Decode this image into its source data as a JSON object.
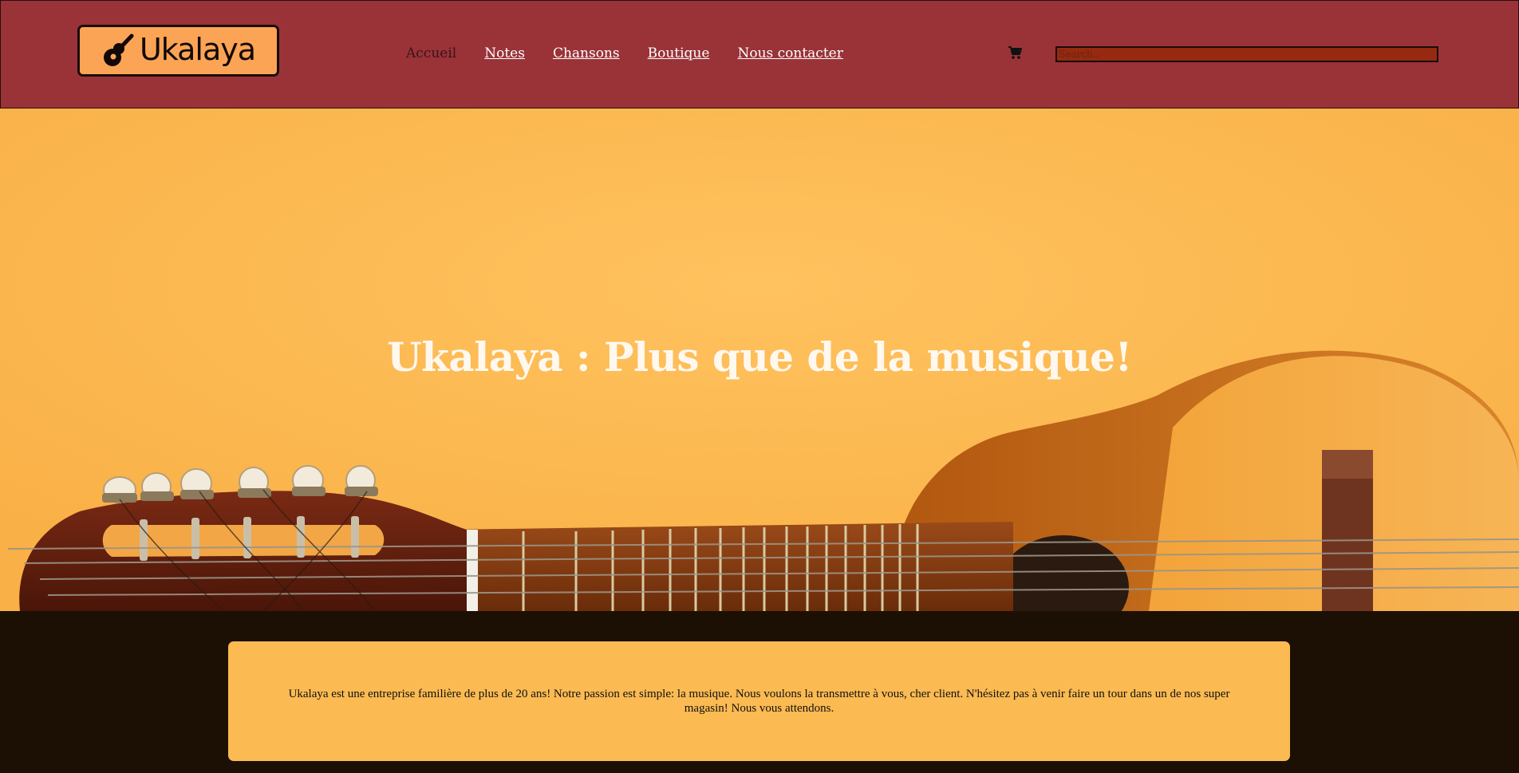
{
  "header": {
    "logo": {
      "text": "Ukalaya",
      "icon": "guitar-icon"
    },
    "nav": [
      {
        "label": "Accueil",
        "current": true
      },
      {
        "label": "Notes"
      },
      {
        "label": "Chansons"
      },
      {
        "label": "Boutique"
      },
      {
        "label": "Nous contacter"
      }
    ],
    "cart": {
      "icon": "cart-icon"
    },
    "search": {
      "placeholder": "Search..",
      "value": ""
    }
  },
  "hero": {
    "title": "Ukalaya : Plus que de la musique!",
    "background": "guitar-photo"
  },
  "intro": {
    "text": "Ukalaya est une entreprise familière de plus de 20 ans! Notre passion est simple: la musique. Nous voulons la transmettre à vous, cher client. N'hésitez pas à venir faire un tour dans un de nos super magasin! Nous vous attendons."
  },
  "colors": {
    "header_bg": "#993338",
    "logo_bg": "#fca455",
    "hero_bg": "#fdb94f",
    "page_bg": "#1c1005",
    "card_bg": "#fbba52"
  }
}
